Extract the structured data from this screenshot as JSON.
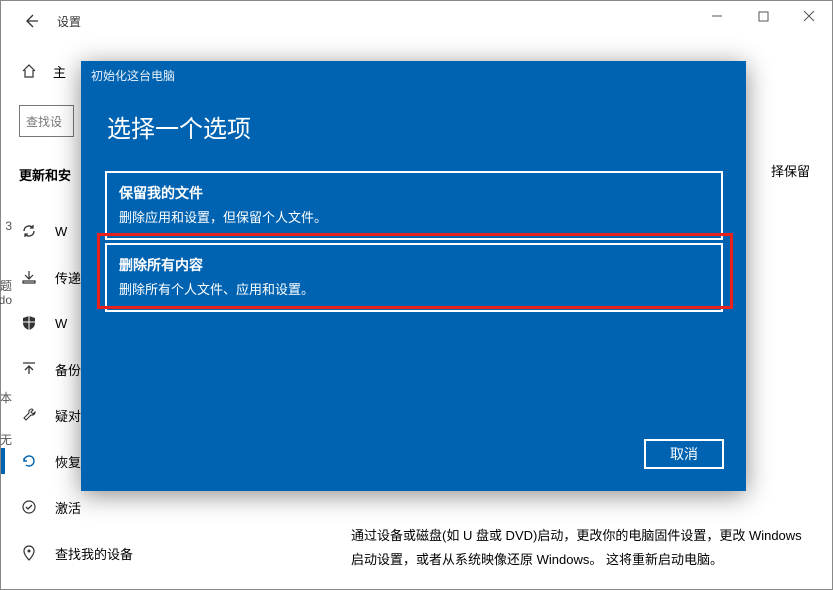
{
  "window": {
    "title": "设置"
  },
  "home_label": "主",
  "search_placeholder": "查找设",
  "section_title": "更新和安",
  "nav": {
    "items": [
      {
        "label": "W"
      },
      {
        "label": "传递"
      },
      {
        "label": "W"
      },
      {
        "label": "备份"
      },
      {
        "label": "疑对"
      },
      {
        "label": "恢复"
      },
      {
        "label": "激活"
      },
      {
        "label": "查找我的设备"
      }
    ]
  },
  "right_snip": "择保留",
  "right_bottom": "通过设备或磁盘(如 U 盘或 DVD)启动，更改你的电脑固件设置，更改 Windows 启动设置，或者从系统映像还原 Windows。  这将重新启动电脑。",
  "modal": {
    "title": "初始化这台电脑",
    "heading": "选择一个选项",
    "options": [
      {
        "title": "保留我的文件",
        "desc": "删除应用和设置，但保留个人文件。"
      },
      {
        "title": "删除所有内容",
        "desc": "删除所有个人文件、应用和设置。"
      }
    ],
    "cancel": "取消"
  },
  "bleed": {
    "a": "3",
    "b": "题",
    "c": "do",
    "d": "本",
    "e": "无"
  }
}
